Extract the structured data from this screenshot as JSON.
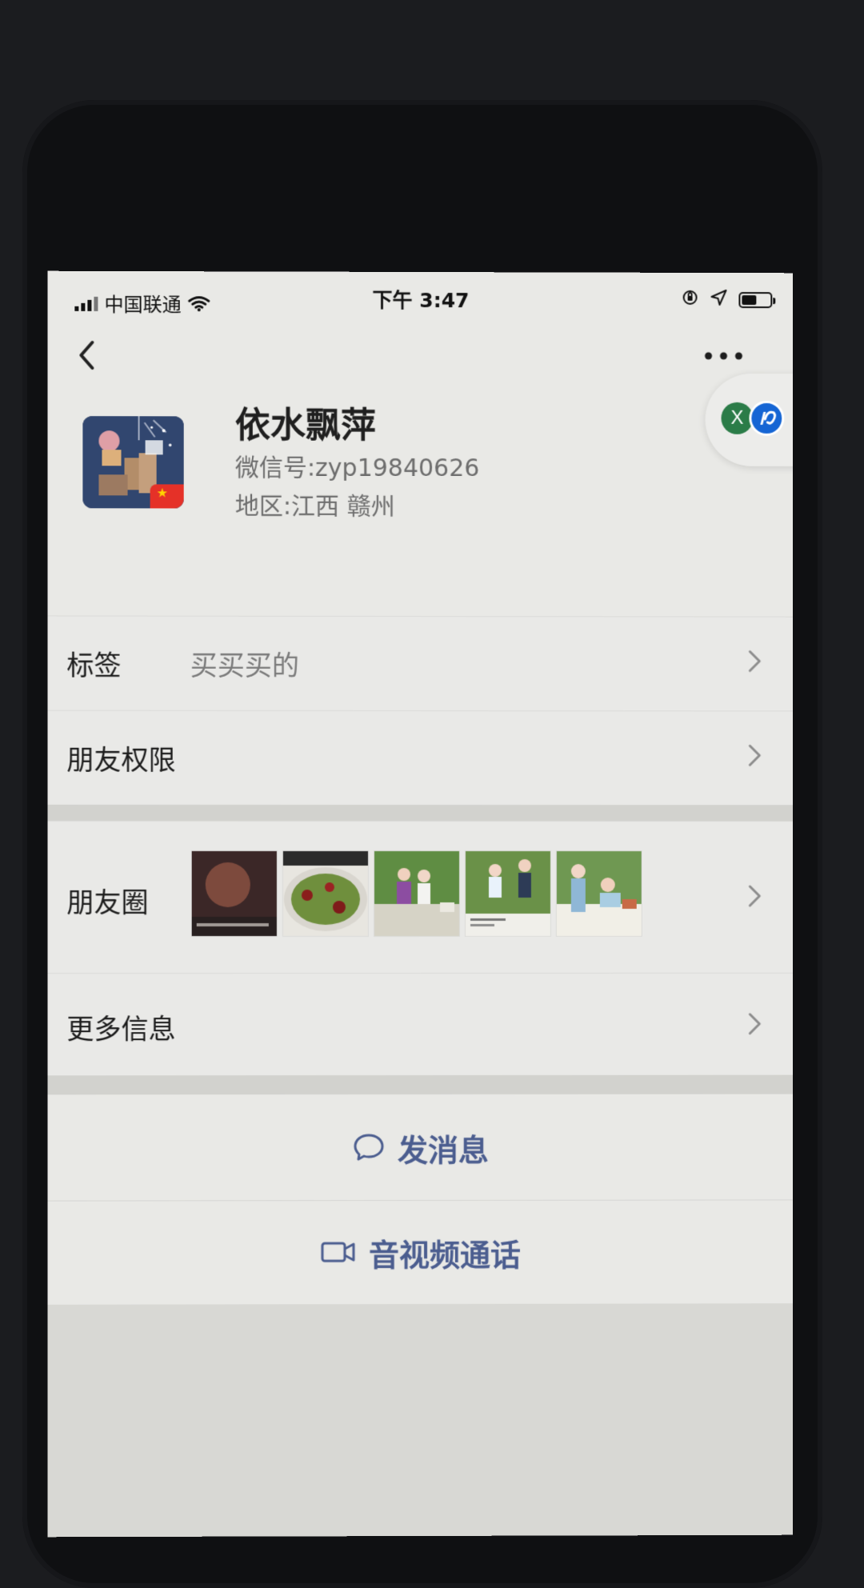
{
  "status_bar": {
    "carrier": "中国联通",
    "time": "下午 3:47"
  },
  "profile": {
    "name": "依水飘萍",
    "wechat_id_label": "微信号:",
    "wechat_id": "zyp19840626",
    "region_label": "地区:",
    "region": "江西 赣州"
  },
  "rows": {
    "tag_label": "标签",
    "tag_value": "买买买的",
    "permission_label": "朋友权限",
    "moments_label": "朋友圈",
    "more_info_label": "更多信息"
  },
  "actions": {
    "send_message": "发消息",
    "video_call": "音视频通话"
  },
  "floating_pill": {
    "left_icon_text": "X"
  },
  "colors": {
    "screen_bg": "#e9e9e6",
    "action_blue": "#4b5d8f",
    "wechat_green": "#2b7c48",
    "flag_red": "#e53128"
  }
}
